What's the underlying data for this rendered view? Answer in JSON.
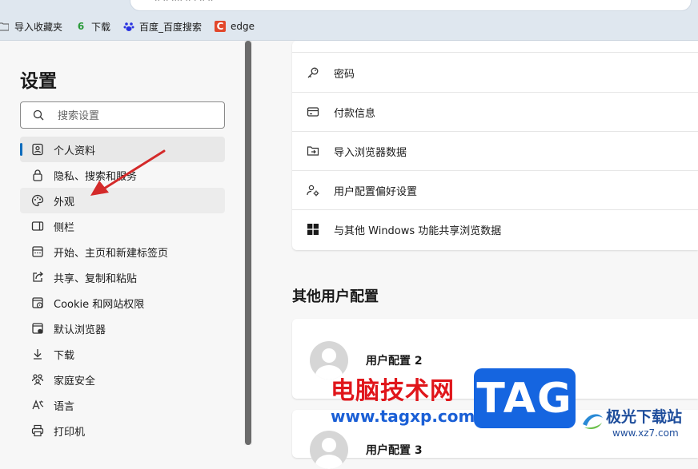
{
  "address_bar": {
    "text": "·· ·· ···· ·· · ·· ··"
  },
  "favorites": [
    {
      "icon": "folder-icon",
      "label": "导入收藏夹"
    },
    {
      "icon": "download-6-icon",
      "label": "下载",
      "glyph": "6"
    },
    {
      "icon": "baidu-paw-icon",
      "label": "百度_百度搜索"
    },
    {
      "icon": "edge-c-icon",
      "label": "edge",
      "glyph": "C"
    }
  ],
  "sidebar": {
    "title": "设置",
    "search_placeholder": "搜索设置",
    "items": [
      {
        "label": "个人资料",
        "icon": "profile-icon",
        "state": "active"
      },
      {
        "label": "隐私、搜索和服务",
        "icon": "lock-icon"
      },
      {
        "label": "外观",
        "icon": "palette-icon",
        "state": "hover"
      },
      {
        "label": "侧栏",
        "icon": "sidebar-icon"
      },
      {
        "label": "开始、主页和新建标签页",
        "icon": "home-tab-icon"
      },
      {
        "label": "共享、复制和粘贴",
        "icon": "share-icon"
      },
      {
        "label": "Cookie 和网站权限",
        "icon": "cookie-icon"
      },
      {
        "label": "默认浏览器",
        "icon": "browser-icon"
      },
      {
        "label": "下载",
        "icon": "download-icon"
      },
      {
        "label": "家庭安全",
        "icon": "family-icon"
      },
      {
        "label": "语言",
        "icon": "language-icon"
      },
      {
        "label": "打印机",
        "icon": "printer-icon"
      }
    ]
  },
  "main": {
    "profile_rows": [
      {
        "label": "",
        "icon": "partial-icon"
      },
      {
        "label": "密码",
        "icon": "key-icon"
      },
      {
        "label": "付款信息",
        "icon": "card-icon"
      },
      {
        "label": "导入浏览器数据",
        "icon": "import-icon"
      },
      {
        "label": "用户配置偏好设置",
        "icon": "profile-settings-icon"
      },
      {
        "label": "与其他 Windows 功能共享浏览数据",
        "icon": "windows-icon"
      }
    ],
    "other_profiles_title": "其他用户配置",
    "other_profiles": [
      {
        "name": "用户配置 2"
      },
      {
        "name": "用户配置 3"
      }
    ]
  },
  "watermark": {
    "site_name": "电脑技术网",
    "site_url": "www.tagxp.com",
    "tag_logo": "TAG",
    "jg_name": "极光下载站",
    "jg_url": "www.xz7.com"
  },
  "colors": {
    "accent": "#0f6cbd",
    "arrow": "#d42a2a",
    "watermark_red": "#e0161b",
    "watermark_blue": "#1565e0"
  }
}
